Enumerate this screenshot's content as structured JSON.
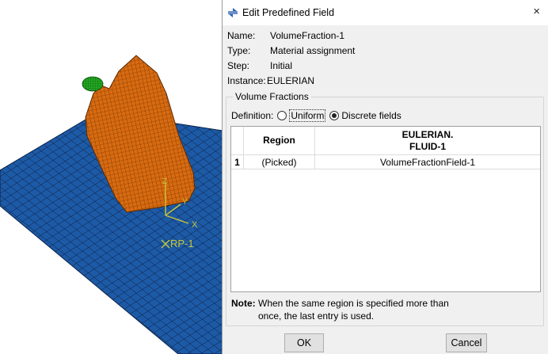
{
  "viewport": {
    "triad": {
      "z": "Z",
      "y": "Y",
      "x": "X"
    },
    "ref_point_label": "RP-1",
    "colors": {
      "floor": "#1d5aa6",
      "mesh_line": "#0a1f44",
      "body": "#d86a10",
      "cap": "#22a822",
      "triad": "#c8c83a"
    }
  },
  "dialog": {
    "title": "Edit Predefined Field",
    "close": "×",
    "icon": "edit-field-icon",
    "fields": {
      "name_label": "Name:",
      "name_value": "VolumeFraction-1",
      "type_label": "Type:",
      "type_value": "Material assignment",
      "step_label": "Step:",
      "step_value": "Initial",
      "instance_label": "Instance:",
      "instance_value": "EULERIAN"
    },
    "group_title": "Volume Fractions",
    "definition": {
      "label": "Definition:",
      "options": [
        "Uniform",
        "Discrete fields"
      ],
      "selected": "Discrete fields"
    },
    "table": {
      "headers": [
        "",
        "Region",
        "EULERIAN.",
        "FLUID-1"
      ],
      "rows": [
        {
          "index": "1",
          "region": "(Picked)",
          "value": "VolumeFractionField-1"
        }
      ]
    },
    "note": {
      "label": "Note:",
      "line1": "When the same region is specified more than",
      "line2": "once, the last entry is used."
    },
    "buttons": {
      "ok": "OK",
      "cancel": "Cancel"
    }
  }
}
